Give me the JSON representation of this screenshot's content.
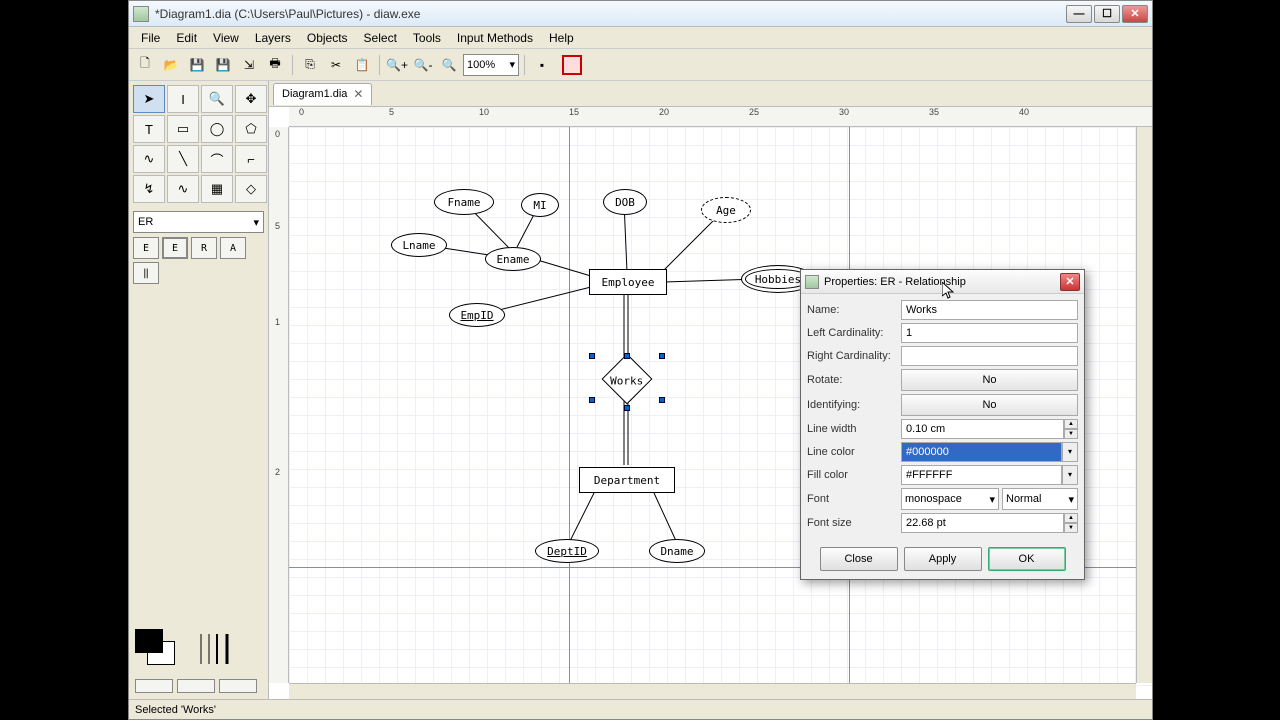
{
  "window": {
    "title": "*Diagram1.dia (C:\\Users\\Paul\\Pictures) - diaw.exe"
  },
  "menu": [
    "File",
    "Edit",
    "View",
    "Layers",
    "Objects",
    "Select",
    "Tools",
    "Input Methods",
    "Help"
  ],
  "zoom": "100%",
  "tab": {
    "label": "Diagram1.dia"
  },
  "shape_category": "ER",
  "er_buttons": [
    "E",
    "E",
    "R",
    "A"
  ],
  "ruler_h": [
    "0",
    "5",
    "10",
    "15",
    "20",
    "25",
    "30",
    "35",
    "40"
  ],
  "ruler_v": [
    "0",
    "5",
    "1",
    "2"
  ],
  "entities": {
    "fname": "Fname",
    "mi": "MI",
    "dob": "DOB",
    "age": "Age",
    "lname": "Lname",
    "ename": "Ename",
    "employee": "Employee",
    "hobbies": "Hobbies",
    "empid": "EmpID",
    "works": "Works",
    "department": "Department",
    "deptid": "DeptID",
    "dname": "Dname"
  },
  "dialog": {
    "title": "Properties: ER - Relationship",
    "labels": {
      "name": "Name:",
      "leftcard": "Left Cardinality:",
      "rightcard": "Right Cardinality:",
      "rotate": "Rotate:",
      "identifying": "Identifying:",
      "linewidth": "Line width",
      "linecolor": "Line color",
      "fillcolor": "Fill color",
      "font": "Font",
      "fontsize": "Font size"
    },
    "values": {
      "name": "Works",
      "leftcard": "1",
      "rightcard": "",
      "rotate": "No",
      "identifying": "No",
      "linewidth": "0.10 cm",
      "linecolor": "#000000",
      "fillcolor": "#FFFFFF",
      "font": "monospace",
      "fontstyle": "Normal",
      "fontsize": "22.68 pt"
    },
    "buttons": {
      "close": "Close",
      "apply": "Apply",
      "ok": "OK"
    }
  },
  "status": "Selected 'Works'"
}
